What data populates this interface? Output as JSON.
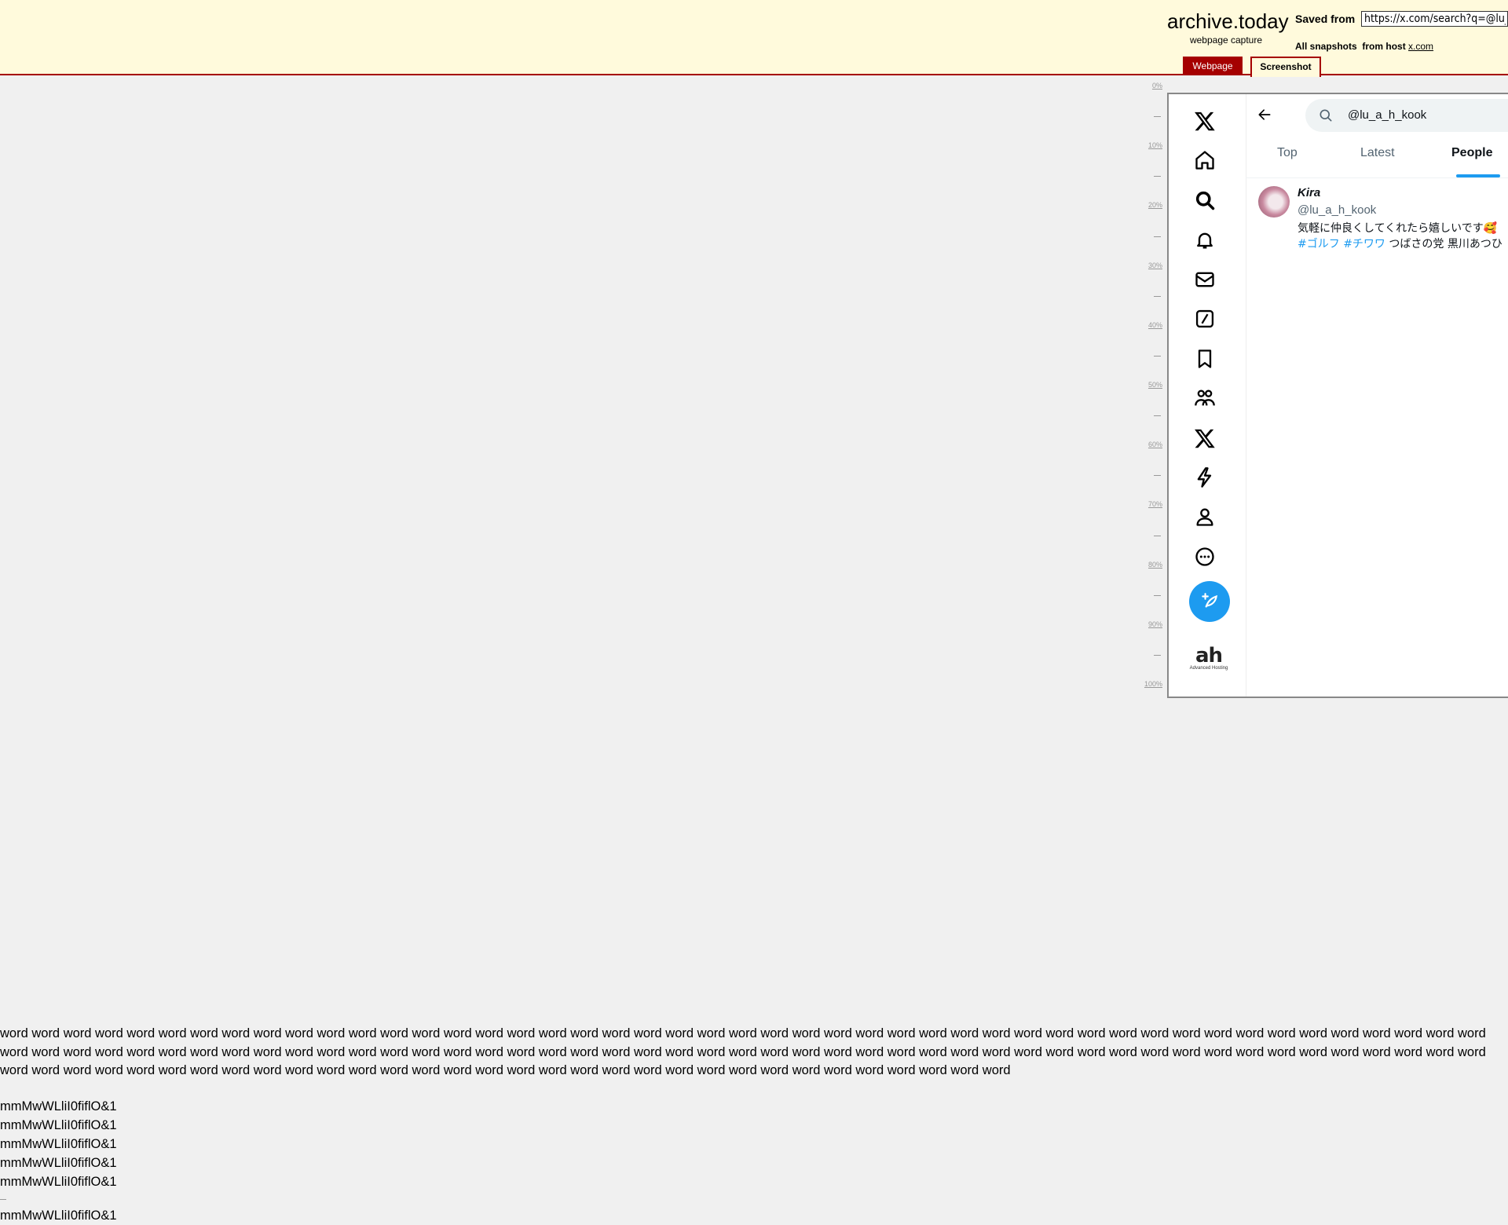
{
  "archive": {
    "brand_title": "archive.today",
    "brand_subtitle": "webpage capture",
    "saved_from_label": "Saved from",
    "url_value": "https://x.com/search?q=@lu_a",
    "snapshots_label": "All snapshots",
    "from_host_label": "from host",
    "host_link": "x.com",
    "tabs": {
      "webpage": "Webpage",
      "screenshot": "Screenshot"
    },
    "accent_color": "#a50000",
    "header_bg": "#fffadc"
  },
  "ruler": {
    "labels": [
      "0%",
      "10%",
      "20%",
      "30%",
      "40%",
      "50%",
      "60%",
      "70%",
      "80%",
      "90%",
      "100%"
    ]
  },
  "x_app": {
    "nav_icons": [
      "x-logo-icon",
      "home-icon",
      "search-icon",
      "bell-icon",
      "mail-icon",
      "grok-icon",
      "bookmark-icon",
      "communities-icon",
      "premium-icon",
      "lightning-icon",
      "profile-icon",
      "more-icon"
    ],
    "post_button_icon": "feather-plus-icon",
    "sidebar_logo": {
      "mark": "ah",
      "text": "Advanced Hosting"
    },
    "search": {
      "query": "@lu_a_h_kook"
    },
    "tabs": [
      "Top",
      "Latest",
      "People"
    ],
    "active_tab": "People",
    "accent_color": "#1d9bf0",
    "user": {
      "name": "Kira",
      "handle": "@lu_a_h_kook",
      "bio_line1": "気軽に仲良くしてくれたら嬉しいです🥰",
      "bio_hashtag1": "#ゴルフ",
      "bio_hashtag2": "#チワワ",
      "bio_line2_rest": "つばさの党 黒川あつひ"
    }
  },
  "test_text": {
    "word_paragraph": "word word word word word word word word word word word word word word word word word word word word word word word word word word word word word word word word word word word word word word word word word word word word word word word word word word word word word word word word word word word word word word word word word word word word word word word word word word word word word word word word word word word word word word word word word word word word word word word word word word word word word word word word word word word word word word word word word word word word word word word word word word word word word word",
    "glyph_lines": [
      "mmMwWLliI0fiflO&1",
      "mmMwWLliI0fiflO&1",
      "mmMwWLliI0fiflO&1",
      "mmMwWLliI0fiflO&1",
      "mmMwWLliI0fiflO&1"
    ],
    "glyph_line_after": "mmMwWLliI0fiflO&1"
  }
}
